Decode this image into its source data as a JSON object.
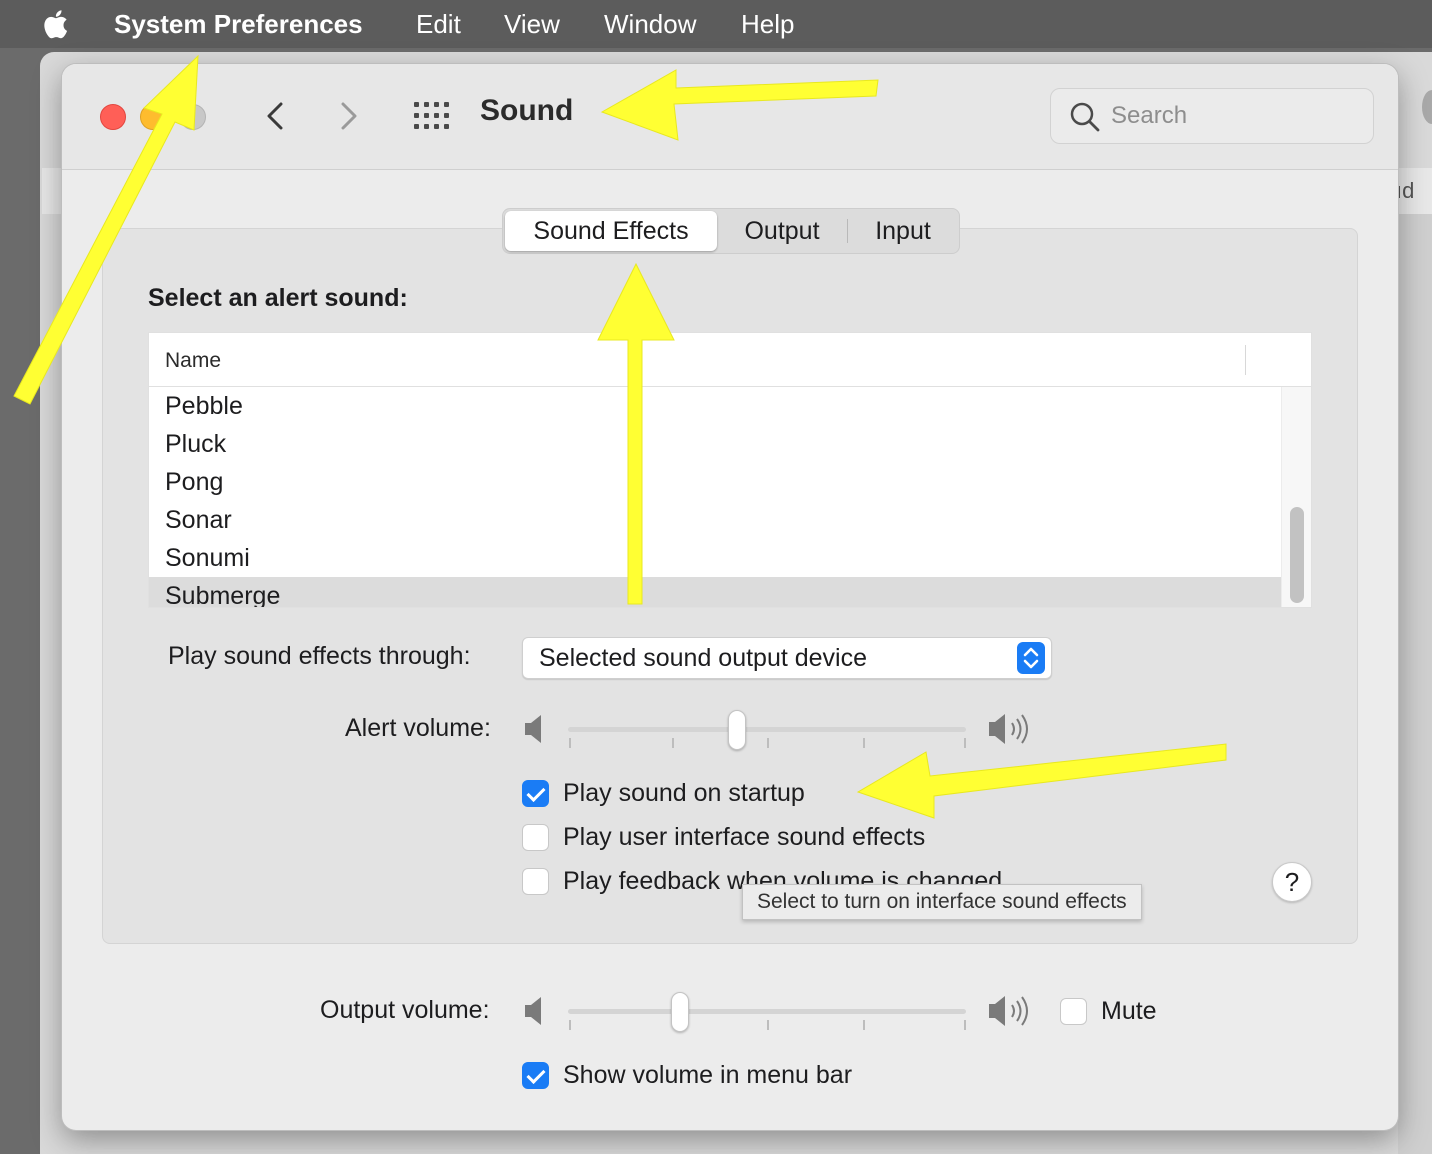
{
  "menubar": {
    "app_name": "System Preferences",
    "items": [
      "Edit",
      "View",
      "Window",
      "Help"
    ]
  },
  "background_window": {
    "partial_text": "ıd"
  },
  "window": {
    "title": "Sound",
    "search_placeholder": "Search"
  },
  "tabs": [
    {
      "label": "Sound Effects",
      "active": true
    },
    {
      "label": "Output",
      "active": false
    },
    {
      "label": "Input",
      "active": false
    }
  ],
  "sound_effects": {
    "alert_label": "Select an alert sound:",
    "column_header": "Name",
    "sounds": [
      "Pebble",
      "Pluck",
      "Pong",
      "Sonar",
      "Sonumi",
      "Submerge"
    ],
    "selected_sound": "Submerge",
    "play_through_label": "Play sound effects through:",
    "play_through_value": "Selected sound output device",
    "alert_volume_label": "Alert volume:",
    "alert_volume_level": 0.42,
    "checkboxes": [
      {
        "label": "Play sound on startup",
        "checked": true
      },
      {
        "label": "Play user interface sound effects",
        "checked": false
      },
      {
        "label": "Play feedback when volume is changed",
        "checked": false
      }
    ],
    "tooltip": "Select to turn on interface sound effects",
    "help_label": "?"
  },
  "output": {
    "output_volume_label": "Output volume:",
    "output_volume_level": 0.27,
    "mute_label": "Mute",
    "mute_checked": false,
    "show_in_menubar_label": "Show volume in menu bar",
    "show_in_menubar_checked": true
  },
  "colors": {
    "accent": "#1a7cf5",
    "annotation_arrow": "#ffff33",
    "close": "#ff5f57",
    "minimize": "#febc2e"
  }
}
